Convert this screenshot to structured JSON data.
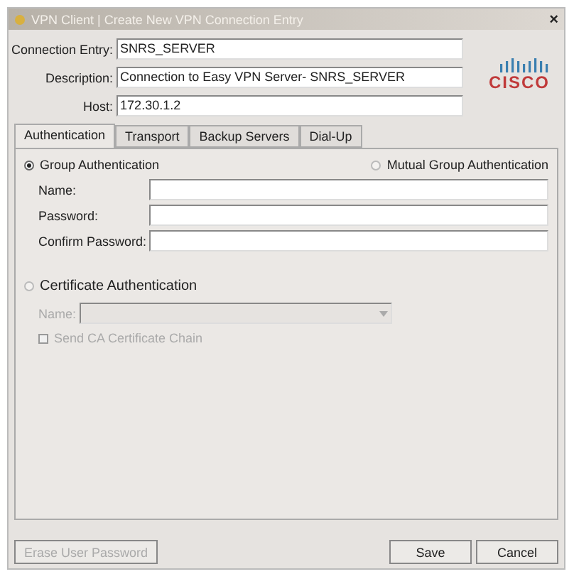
{
  "window": {
    "title": "VPN Client  |  Create New VPN Connection Entry",
    "close": "×"
  },
  "fields": [
    {
      "label": "Connection Entry:",
      "value": "SNRS_SERVER"
    },
    {
      "label": "Description:",
      "value": "Connection to Easy VPN Server- SNRS_SERVER"
    },
    {
      "label": "Host:",
      "value": "172.30.1.2"
    }
  ],
  "logo": "CISCO",
  "tabs": [
    {
      "label": "Authentication",
      "selected": true
    },
    {
      "label": "Transport",
      "selected": false
    },
    {
      "label": "Backup Servers",
      "selected": false
    },
    {
      "label": "Dial-Up",
      "selected": false
    }
  ],
  "auth_options": [
    {
      "label": "Group Authentication",
      "selected": true
    },
    {
      "label": "Mutual Group Authentication",
      "selected": false
    }
  ],
  "group_fields": [
    {
      "label": "Name:"
    },
    {
      "label": "Password:"
    },
    {
      "label": "Confirm Password:"
    }
  ],
  "certificate": {
    "label": "Certificate Authentication",
    "selected": false,
    "name_label": "Name:",
    "disabled": true,
    "send_chain": {
      "label": "Send CA Certificate Chain",
      "checked": false
    }
  },
  "buttons": [
    {
      "label": "Erase User Password",
      "disabled": true
    },
    {
      "label": "Save",
      "disabled": false
    },
    {
      "label": "Cancel",
      "disabled": false
    }
  ]
}
